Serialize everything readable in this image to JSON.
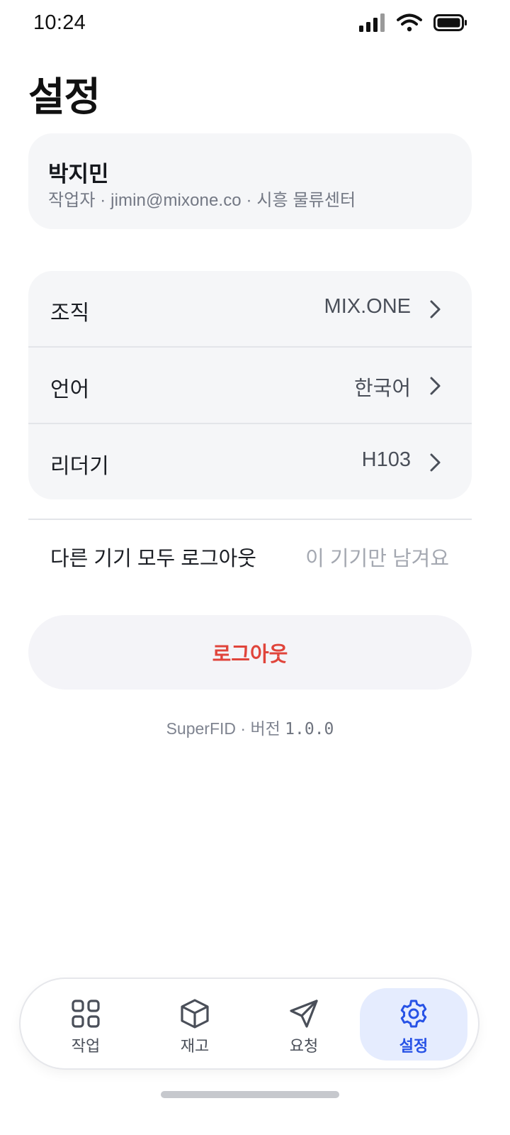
{
  "status_bar": {
    "time": "10:24"
  },
  "page": {
    "title": "설정"
  },
  "profile": {
    "name": "박지민",
    "subtitle": "작업자 · jimin@mixone.co · 시흥 물류센터"
  },
  "settings": {
    "rows": [
      {
        "label": "조직",
        "value": "MIX.ONE"
      },
      {
        "label": "언어",
        "value": "한국어"
      },
      {
        "label": "리더기",
        "value": "H103"
      }
    ]
  },
  "logout_others": {
    "label": "다른 기기 모두 로그아웃",
    "hint": "이 기기만 남겨요"
  },
  "logout": {
    "label": "로그아웃",
    "color": "#e0443b"
  },
  "version": {
    "prefix": "SuperFID · 버전 ",
    "number": "1.0.0"
  },
  "tabbar": {
    "active_color": "#2752e6",
    "tabs": [
      {
        "label": "작업",
        "icon": "grid-icon",
        "active": false
      },
      {
        "label": "재고",
        "icon": "box-icon",
        "active": false
      },
      {
        "label": "요청",
        "icon": "send-icon",
        "active": false
      },
      {
        "label": "설정",
        "icon": "gear-icon",
        "active": true
      }
    ]
  }
}
